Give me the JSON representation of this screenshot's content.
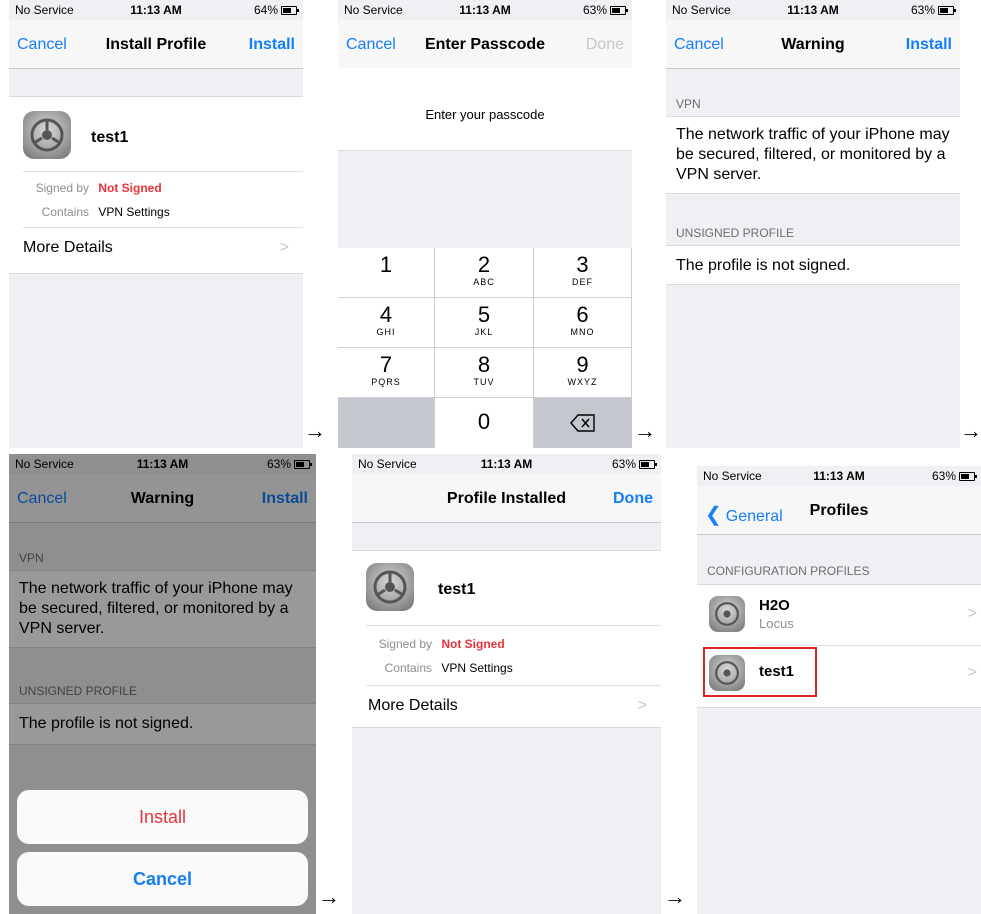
{
  "status": {
    "carrier": "No Service",
    "time": "11:13 AM",
    "battery_1": "64%",
    "battery_2": "63%"
  },
  "arrow_symbol": "→",
  "screen1": {
    "nav_left": "Cancel",
    "nav_title": "Install Profile",
    "nav_right": "Install",
    "profile_name": "test1",
    "signed_by_label": "Signed by",
    "signed_by_value": "Not Signed",
    "contains_label": "Contains",
    "contains_value": "VPN Settings",
    "more_details": "More Details",
    "chevron": ">"
  },
  "screen2": {
    "nav_left": "Cancel",
    "nav_title": "Enter Passcode",
    "nav_right": "Done",
    "prompt": "Enter your passcode",
    "keys": [
      {
        "digit": "1",
        "letters": ""
      },
      {
        "digit": "2",
        "letters": "ABC"
      },
      {
        "digit": "3",
        "letters": "DEF"
      },
      {
        "digit": "4",
        "letters": "GHI"
      },
      {
        "digit": "5",
        "letters": "JKL"
      },
      {
        "digit": "6",
        "letters": "MNO"
      },
      {
        "digit": "7",
        "letters": "PQRS"
      },
      {
        "digit": "8",
        "letters": "TUV"
      },
      {
        "digit": "9",
        "letters": "WXYZ"
      }
    ],
    "zero": "0",
    "delete_icon": "delete-icon"
  },
  "screen3": {
    "nav_left": "Cancel",
    "nav_title": "Warning",
    "nav_right": "Install",
    "vpn_header": "VPN",
    "vpn_text": "The network traffic of your iPhone may be secured, filtered, or monitored by a VPN server.",
    "unsigned_header": "UNSIGNED PROFILE",
    "unsigned_text": "The profile is not signed."
  },
  "screen4": {
    "install_button": "Install",
    "cancel_button": "Cancel"
  },
  "screen5": {
    "nav_title": "Profile Installed",
    "nav_right": "Done",
    "profile_name": "test1",
    "signed_by_label": "Signed by",
    "signed_by_value": "Not Signed",
    "contains_label": "Contains",
    "contains_value": "VPN Settings",
    "more_details": "More Details",
    "chevron": ">"
  },
  "screen6": {
    "back": "General",
    "nav_title": "Profiles",
    "section": "CONFIGURATION PROFILES",
    "profiles": [
      {
        "name": "H2O",
        "sub": "Locus"
      },
      {
        "name": "test1",
        "sub": ""
      }
    ],
    "chevron": ">"
  },
  "colors": {
    "ios_blue": "#147efb",
    "warning_red": "#e8333a",
    "highlight_box": "#e02424"
  }
}
